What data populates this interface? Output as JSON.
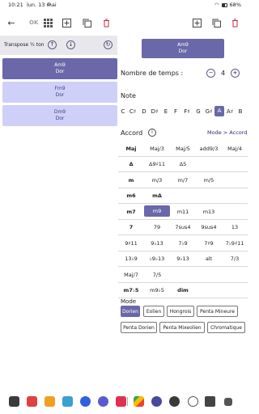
{
  "status_bar": {
    "time": "10:21",
    "date": "lun. 13 mai",
    "notif": "⊙",
    "battery": "68%"
  },
  "toolbar": {
    "ok_label": "OK",
    "icons": [
      "back-arrow-icon",
      "grid-icon",
      "add-icon",
      "copy-icon",
      "delete-icon",
      "add-icon",
      "copy-icon",
      "delete-icon"
    ]
  },
  "left_panel": {
    "transpose_label": "Transpose ½ ton",
    "cards": [
      {
        "name": "Am9",
        "mode": "Dor",
        "active": true
      },
      {
        "name": "Fm9",
        "mode": "Dor",
        "active": false
      },
      {
        "name": "Dm9",
        "mode": "Dor",
        "active": false
      }
    ]
  },
  "top_chord": {
    "name": "Am9",
    "mode": "Dor"
  },
  "tempo": {
    "label": "Nombre de temps :",
    "value": "4"
  },
  "note": {
    "label": "Note",
    "items": [
      "C",
      "C♯",
      "D",
      "D♯",
      "E",
      "F",
      "F♯",
      "G",
      "G♯",
      "A",
      "A♯",
      "B"
    ],
    "selected": "A"
  },
  "accord": {
    "label": "Accord",
    "mode_link": "Mode > Accord",
    "rows": [
      [
        {
          "t": "Maj",
          "b": true
        },
        {
          "t": "Maj/3"
        },
        {
          "t": "Maj/5"
        },
        {
          "t": "add9/3"
        },
        {
          "t": "Maj/4"
        }
      ],
      [
        {
          "t": "Δ",
          "b": true
        },
        {
          "t": "Δ9♯11"
        },
        {
          "t": "Δ5"
        }
      ],
      [
        {
          "t": "m",
          "b": true
        },
        {
          "t": "m/3"
        },
        {
          "t": "m/7"
        },
        {
          "t": "m/5"
        }
      ],
      [
        {
          "t": "m6",
          "b": true
        },
        {
          "t": "mΔ",
          "b": true
        }
      ],
      [
        {
          "t": "m7",
          "b": true
        },
        {
          "t": "m9",
          "sel": true
        },
        {
          "t": "m11"
        },
        {
          "t": "m13"
        }
      ],
      [
        {
          "t": "7",
          "b": true
        },
        {
          "t": "79"
        },
        {
          "t": "7sus4"
        },
        {
          "t": "9sus4"
        },
        {
          "t": "13"
        }
      ],
      [
        {
          "t": "9♯11"
        },
        {
          "t": "9♭13"
        },
        {
          "t": "7♭9"
        },
        {
          "t": "7♯9"
        },
        {
          "t": "7♭9♯11"
        }
      ],
      [
        {
          "t": "13♭9"
        },
        {
          "t": "♭9♭13"
        },
        {
          "t": "9♭13"
        },
        {
          "t": "alt"
        },
        {
          "t": "7/3"
        }
      ],
      [
        {
          "t": "Maj/7"
        },
        {
          "t": "7/5"
        }
      ],
      [
        {
          "t": "m7♭5",
          "b": true
        },
        {
          "t": "m9♭5"
        },
        {
          "t": "dim",
          "b": true
        }
      ]
    ]
  },
  "mode": {
    "label": "Mode",
    "buttons": [
      "Dorien",
      "Eolien",
      "Hongrois",
      "Penta Mineure",
      "Penta Dorien",
      "Penta Mixeolien",
      "Chromatique"
    ],
    "selected": "Dorien"
  },
  "colors": {
    "accent": "#6a68a8",
    "card": "#cfd0f8"
  }
}
